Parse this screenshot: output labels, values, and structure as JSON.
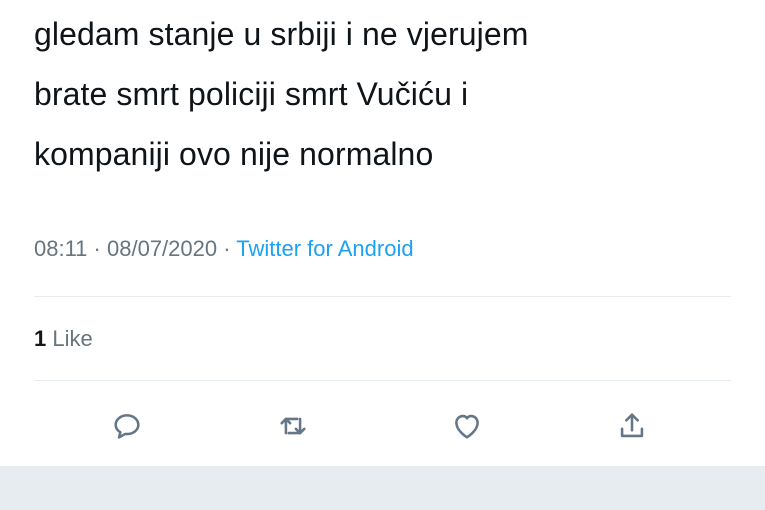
{
  "tweet": {
    "text_lines": [
      "gledam stanje u srbiji i ne vjerujem",
      "brate smrt policiji smrt Vučiću i",
      "kompaniji ovo nije normalno"
    ],
    "time": "08:11",
    "separator": "·",
    "date": "08/07/2020",
    "source": "Twitter for Android"
  },
  "stats": {
    "like_count": "1",
    "like_label": "Like"
  },
  "actions": {
    "reply_icon": "reply-icon",
    "retweet_icon": "retweet-icon",
    "like_icon": "heart-icon",
    "share_icon": "share-icon"
  },
  "colors": {
    "text": "#0f1419",
    "meta": "#66757f",
    "link": "#1da1f2",
    "divider": "#e6ecf0",
    "icon": "#657786",
    "bottom_bar": "#e6ecf0"
  }
}
